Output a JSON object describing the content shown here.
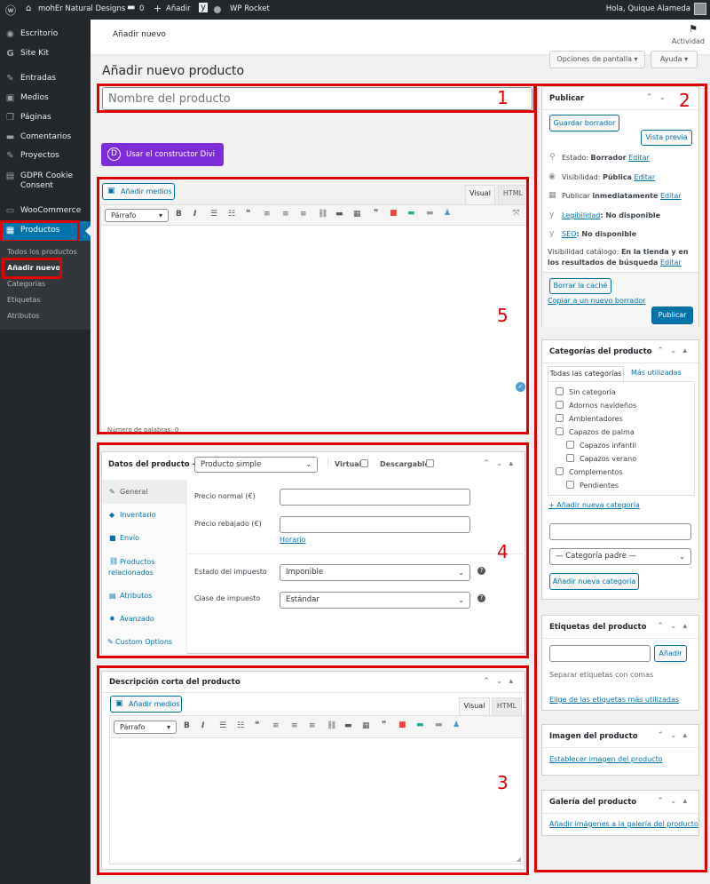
{
  "adminbar": {
    "site_name": "mohEr Natural Designs",
    "comments_count": "0",
    "add_new": "Añadir",
    "wp_rocket": "WP Rocket",
    "greeting": "Hola, Quique Alameda"
  },
  "sidebar": {
    "items": [
      {
        "label": "Escritorio",
        "icon": "dashboard-icon"
      },
      {
        "label": "Site Kit",
        "icon": "sitekit-icon"
      },
      {
        "label": "Entradas",
        "icon": "pin-icon"
      },
      {
        "label": "Medios",
        "icon": "media-icon"
      },
      {
        "label": "Páginas",
        "icon": "pages-icon"
      },
      {
        "label": "Comentarios",
        "icon": "comments-icon"
      },
      {
        "label": "Proyectos",
        "icon": "pin-icon"
      },
      {
        "label": "GDPR Cookie Consent",
        "icon": "lock-icon"
      },
      {
        "label": "WooCommerce",
        "icon": "woo-icon"
      },
      {
        "label": "Productos",
        "icon": "products-icon"
      }
    ],
    "submenu": [
      "Todos los productos",
      "Añadir nuevo",
      "Categorías",
      "Etiquetas",
      "Atributos"
    ]
  },
  "header": {
    "breadcrumb": "Añadir nuevo",
    "activity": "Actividad",
    "screen_options": "Opciones de pantalla ▾",
    "help": "Ayuda ▾",
    "page_title": "Añadir nuevo producto"
  },
  "editor": {
    "title_placeholder": "Nombre del producto",
    "divi_button": "Usar el constructor Divi",
    "add_media": "Añadir medios",
    "tab_visual": "Visual",
    "tab_html": "HTML",
    "format_select": "Párrafo",
    "word_count": "Número de palabras: 0"
  },
  "product_data": {
    "title": "Datos del producto —",
    "type": "Producto simple",
    "virtual": "Virtual:",
    "downloadable": "Descargable:",
    "tabs": [
      "General",
      "Inventario",
      "Envío",
      "Productos relacionados",
      "Atributos",
      "Avanzado",
      "Custom Options"
    ],
    "regular_price": "Precio normal (€)",
    "sale_price": "Precio rebajado (€)",
    "schedule": "Horario",
    "tax_status": "Estado del impuesto",
    "tax_status_value": "Imponible",
    "tax_class": "Clase de impuesto",
    "tax_class_value": "Estándar"
  },
  "short_description": {
    "title": "Descripción corta del producto",
    "add_media": "Añadir medios",
    "tab_visual": "Visual",
    "tab_html": "HTML",
    "format_select": "Párrafo"
  },
  "publish": {
    "title": "Publicar",
    "save_draft": "Guardar borrador",
    "preview": "Vista previa",
    "status_label": "Estado:",
    "status_value": "Borrador",
    "edit": "Editar",
    "visibility_label": "Visibilidad:",
    "visibility_value": "Pública",
    "publish_label": "Publicar",
    "publish_value": "inmediatamente",
    "readability_link": "Legibilidad",
    "readability_value": ": No disponible",
    "seo_link": "SEO",
    "seo_value": ": No disponible",
    "catalog_label": "Visibilidad catálogo:",
    "catalog_value": "En la tienda y en los resultados de búsqueda",
    "clear_cache": "Borrar la caché",
    "copy_draft": "Copiar a un nuevo borrador",
    "publish_button": "Publicar"
  },
  "categories": {
    "title": "Categorías del producto",
    "tab_all": "Todas las categorías",
    "tab_most": "Más utilizadas",
    "items": [
      {
        "label": "Sin categoría",
        "level": 0
      },
      {
        "label": "Adornos navideños",
        "level": 0
      },
      {
        "label": "Ambientadores",
        "level": 0
      },
      {
        "label": "Capazos de palma",
        "level": 0
      },
      {
        "label": "Capazos infantil",
        "level": 1
      },
      {
        "label": "Capazos verano",
        "level": 1
      },
      {
        "label": "Complementos",
        "level": 0
      },
      {
        "label": "Pendientes",
        "level": 1
      }
    ],
    "add_link": "+ Añadir nueva categoría",
    "parent_select": "— Categoría padre —",
    "add_button": "Añadir nueva categoría"
  },
  "tags": {
    "title": "Etiquetas del producto",
    "add_button": "Añadir",
    "hint": "Separar etiquetas con comas",
    "most_used": "Elige de las etiquetas más utilizadas"
  },
  "image": {
    "title": "Imagen del producto",
    "set_link": "Establecer imagen del producto"
  },
  "gallery": {
    "title": "Galería del producto",
    "add_link": "Añadir imágenes a la galería del producto"
  },
  "annotations": [
    "1",
    "2",
    "3",
    "4",
    "5"
  ],
  "colors": {
    "accent": "#0073aa",
    "annotation": "#e00000",
    "divi": "#7e2bd9",
    "adminbar": "#23282d"
  }
}
